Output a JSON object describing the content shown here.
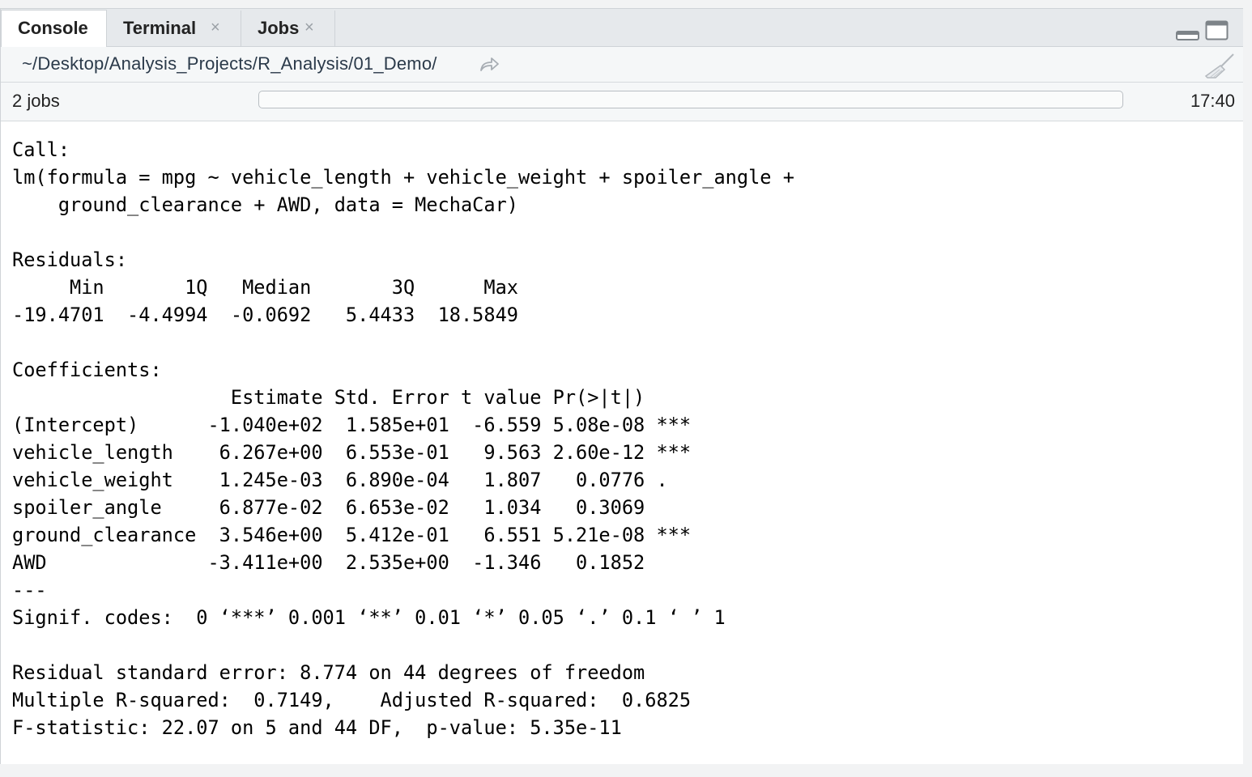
{
  "tabs": [
    {
      "label": "Console",
      "active": true,
      "closable": false
    },
    {
      "label": "Terminal",
      "active": false,
      "closable": true
    },
    {
      "label": "Jobs",
      "active": false,
      "closable": true
    }
  ],
  "path": "~/Desktop/Analysis_Projects/R_Analysis/01_Demo/",
  "jobs": {
    "count_label": "2 jobs",
    "elapsed": "17:40",
    "progress": 0
  },
  "console": {
    "lines": [
      "Call:",
      "lm(formula = mpg ~ vehicle_length + vehicle_weight + spoiler_angle + ",
      "    ground_clearance + AWD, data = MechaCar)",
      "",
      "Residuals:",
      "     Min       1Q   Median       3Q      Max ",
      "-19.4701  -4.4994  -0.0692   5.4433  18.5849 ",
      "",
      "Coefficients:",
      "                   Estimate Std. Error t value Pr(>|t|)    ",
      "(Intercept)      -1.040e+02  1.585e+01  -6.559 5.08e-08 ***",
      "vehicle_length    6.267e+00  6.553e-01   9.563 2.60e-12 ***",
      "vehicle_weight    1.245e-03  6.890e-04   1.807   0.0776 .  ",
      "spoiler_angle     6.877e-02  6.653e-02   1.034   0.3069    ",
      "ground_clearance  3.546e+00  5.412e-01   6.551 5.21e-08 ***",
      "AWD              -3.411e+00  2.535e+00  -1.346   0.1852    ",
      "---",
      "Signif. codes:  0 ‘***’ 0.001 ‘**’ 0.01 ‘*’ 0.05 ‘.’ 0.1 ‘ ’ 1",
      "",
      "Residual standard error: 8.774 on 44 degrees of freedom",
      "Multiple R-squared:  0.7149,\tAdjusted R-squared:  0.6825 ",
      "F-statistic: 22.07 on 5 and 44 DF,  p-value: 5.35e-11"
    ]
  },
  "icons": {
    "tab_close": "close-icon",
    "minimize": "minimize-pane-icon",
    "maximize": "maximize-pane-icon",
    "path_go": "go-to-directory-icon",
    "clear": "broom-clear-icon"
  },
  "colors": {
    "tabbar_bg": "#e6e9ec",
    "border": "#cfd3d7",
    "path_text": "#2b3a4a"
  }
}
